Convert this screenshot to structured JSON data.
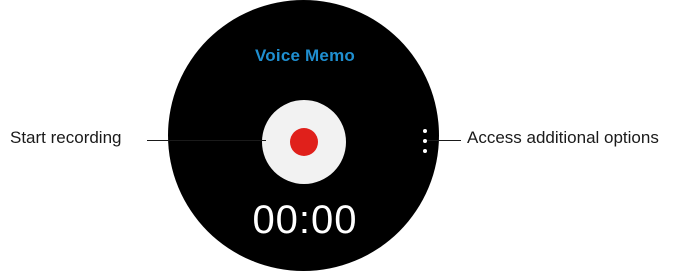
{
  "app": {
    "title": "Voice Memo",
    "timer": "00:00"
  },
  "callouts": {
    "record": "Start recording",
    "options": "Access additional options"
  },
  "colors": {
    "title": "#1f8fd0",
    "record_dot": "#e0201b",
    "record_button": "#f2f2f2",
    "screen_bg": "#000000"
  },
  "icons": {
    "record": "record-dot-icon",
    "options": "more-vertical-icon"
  }
}
